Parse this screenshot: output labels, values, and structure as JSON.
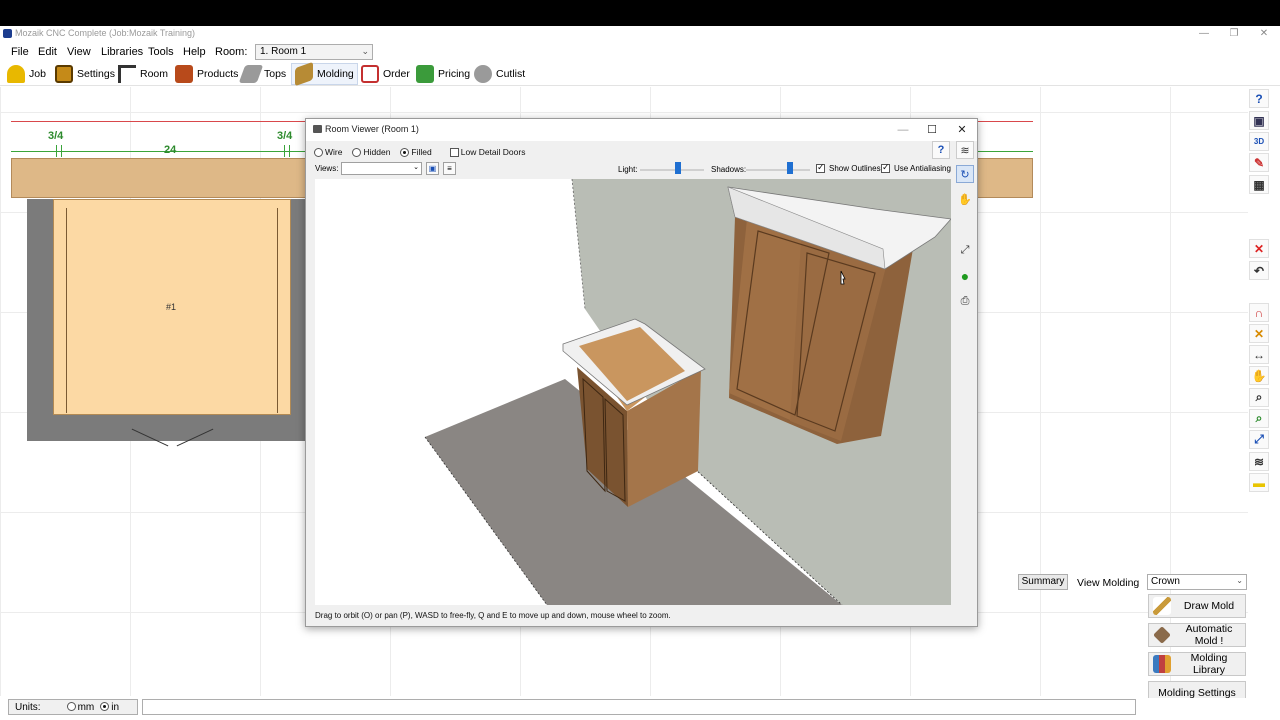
{
  "app": {
    "title": "Mozaik CNC Complete (Job:Mozaik Training)",
    "minimize_glyph": "—",
    "restore_glyph": "❐",
    "close_glyph": "✕"
  },
  "menu": {
    "items": [
      "File",
      "Edit",
      "View",
      "Libraries",
      "Tools",
      "Help"
    ],
    "room_label": "Room:",
    "room_value": "1. Room 1"
  },
  "toolbar": {
    "items": [
      {
        "label": "Job",
        "icon": "hardhat-icon",
        "color": "#e8b800"
      },
      {
        "label": "Settings",
        "icon": "settings-icon",
        "color": "#c58a18"
      },
      {
        "label": "Room",
        "icon": "room-icon",
        "color": "#444444"
      },
      {
        "label": "Products",
        "icon": "products-icon",
        "color": "#b84a1b"
      },
      {
        "label": "Tops",
        "icon": "tops-icon",
        "color": "#7a7a7a"
      },
      {
        "label": "Molding",
        "icon": "molding-icon",
        "color": "#b78b35"
      },
      {
        "label": "Order",
        "icon": "order-icon",
        "color": "#c43030"
      },
      {
        "label": "Pricing",
        "icon": "pricing-icon",
        "color": "#3b9b3b"
      },
      {
        "label": "Cutlist",
        "icon": "cutlist-icon",
        "color": "#888888"
      }
    ],
    "active": "Molding"
  },
  "canvas": {
    "dimensions": [
      "3/4",
      "24",
      "3/4"
    ],
    "cabinet_label": "#1"
  },
  "right_tools": [
    {
      "name": "help-icon",
      "glyph": "?",
      "color": "#1a4fb5"
    },
    {
      "name": "save-icon",
      "glyph": "▣",
      "color": "#335"
    },
    {
      "name": "3d-view-icon",
      "glyph": "3D",
      "color": "#1a4fb5"
    },
    {
      "name": "pencil-icon",
      "glyph": "✎",
      "color": "#c33"
    },
    {
      "name": "grid-icon",
      "glyph": "▦",
      "color": "#333"
    },
    {
      "name": "delete-icon",
      "glyph": "✕",
      "color": "#d22"
    },
    {
      "name": "undo-icon",
      "glyph": "↶",
      "color": "#333"
    },
    {
      "name": "magnet-icon",
      "glyph": "∩",
      "color": "#c33"
    },
    {
      "name": "measure-icon",
      "glyph": "✕",
      "color": "#d88a00"
    },
    {
      "name": "dimension-icon",
      "glyph": "↔",
      "color": "#333"
    },
    {
      "name": "pan-hand-icon",
      "glyph": "✋",
      "color": "#444"
    },
    {
      "name": "zoom-icon",
      "glyph": "⌕",
      "color": "#333"
    },
    {
      "name": "zoom-fit-icon",
      "glyph": "⌕",
      "color": "#2a8a2a"
    },
    {
      "name": "zoom-extents-icon",
      "glyph": "⤢",
      "color": "#1a4fb5"
    },
    {
      "name": "layers-icon",
      "glyph": "≋",
      "color": "#333"
    },
    {
      "name": "note-icon",
      "glyph": "▬",
      "color": "#e8c400"
    }
  ],
  "molding_panel": {
    "summary_label": "Summary",
    "view_label": "View Molding",
    "type_value": "Crown",
    "buttons": [
      {
        "label": "Draw Mold",
        "icon": "draw-mold-icon",
        "color": "#c99a3a"
      },
      {
        "label": "Automatic Mold !",
        "icon": "automatic-mold-icon",
        "color": "#8a6a4a"
      },
      {
        "label": "Molding Library",
        "icon": "molding-library-icon",
        "color": "#3a7ac0"
      },
      {
        "label": "Molding Settings",
        "icon": "",
        "color": ""
      }
    ]
  },
  "statusbar": {
    "units_label": "Units:",
    "mm_label": "mm",
    "in_label": "in",
    "selected_unit": "in"
  },
  "room_viewer": {
    "title": "Room Viewer (Room 1)",
    "render_modes": [
      "Wire",
      "Hidden",
      "Filled"
    ],
    "selected_mode": "Filled",
    "low_detail_label": "Low Detail Doors",
    "views_label": "Views:",
    "views_value": "",
    "light_label": "Light:",
    "light_level": 0.6,
    "shadows_label": "Shadows:",
    "shadows_level": 0.7,
    "show_outlines_label": "Show Outlines",
    "antialias_label": "Use Antialiasing",
    "status_text": "Drag to orbit (O) or pan (P), WASD to free-fly, Q and E to move up and down, mouse wheel to zoom.",
    "help_glyph": "?"
  }
}
